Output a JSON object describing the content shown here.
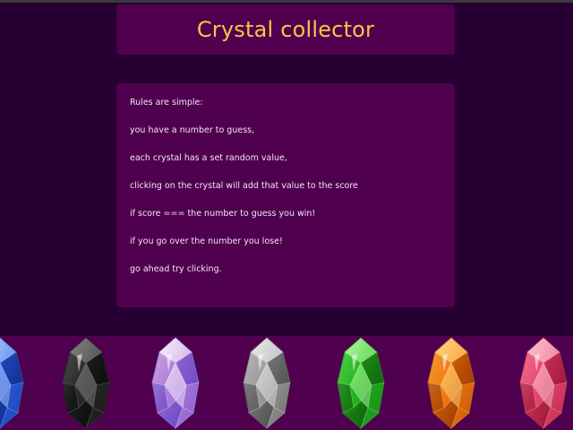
{
  "game": {
    "title": "Crystal collector",
    "rules": [
      "Rules are simple:",
      "you have a number to guess,",
      "each crystal has a set random value,",
      "clicking on the crystal will add that value to the score",
      "if score === the number to guess you win!",
      "if you go over the number you lose!",
      "go ahead try clicking."
    ]
  },
  "crystals": [
    {
      "name": "blue-crystal",
      "base": "#2b5fe0",
      "light": "#b9d4ff",
      "dark": "#0c1f7a"
    },
    {
      "name": "black-crystal",
      "base": "#2a2a2a",
      "light": "#8a8a8a",
      "dark": "#050505"
    },
    {
      "name": "iridescent-crystal",
      "base": "#b07ad8",
      "light": "#ffffff",
      "dark": "#5a3cc2"
    },
    {
      "name": "silver-crystal",
      "base": "#9a9a9a",
      "light": "#f2f2f2",
      "dark": "#3a3a3a"
    },
    {
      "name": "green-crystal",
      "base": "#23b51f",
      "light": "#b8ffa8",
      "dark": "#0b4a08"
    },
    {
      "name": "orange-crystal",
      "base": "#f07a10",
      "light": "#ffe08a",
      "dark": "#8a2a00"
    },
    {
      "name": "pink-crystal",
      "base": "#e8456c",
      "light": "#ffd2dc",
      "dark": "#8a0c2a"
    }
  ]
}
